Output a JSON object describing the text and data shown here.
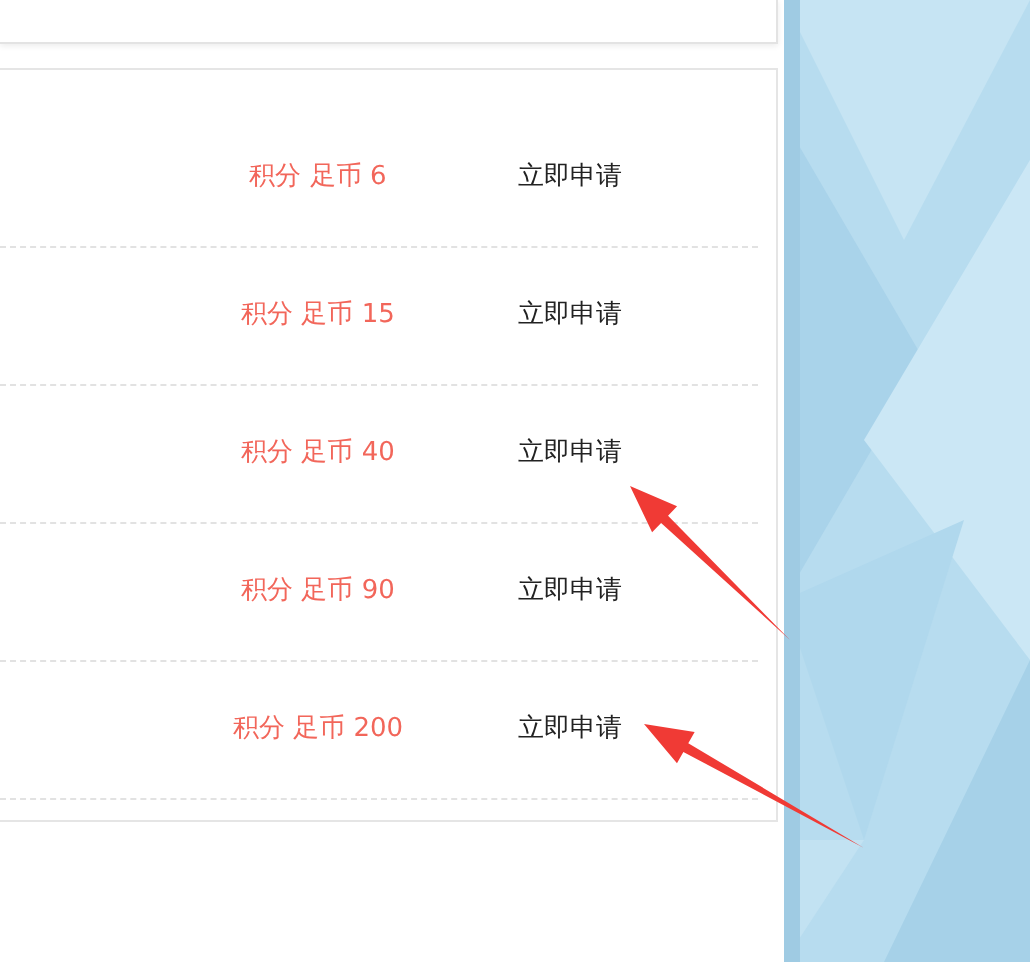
{
  "rows": [
    {
      "price": "积分 足币 6",
      "action": "立即申请"
    },
    {
      "price": "积分 足币 15",
      "action": "立即申请"
    },
    {
      "price": "积分 足币 40",
      "action": "立即申请"
    },
    {
      "price": "积分 足币 90",
      "action": "立即申请"
    },
    {
      "price": "积分 足币 200",
      "action": "立即申请"
    }
  ]
}
